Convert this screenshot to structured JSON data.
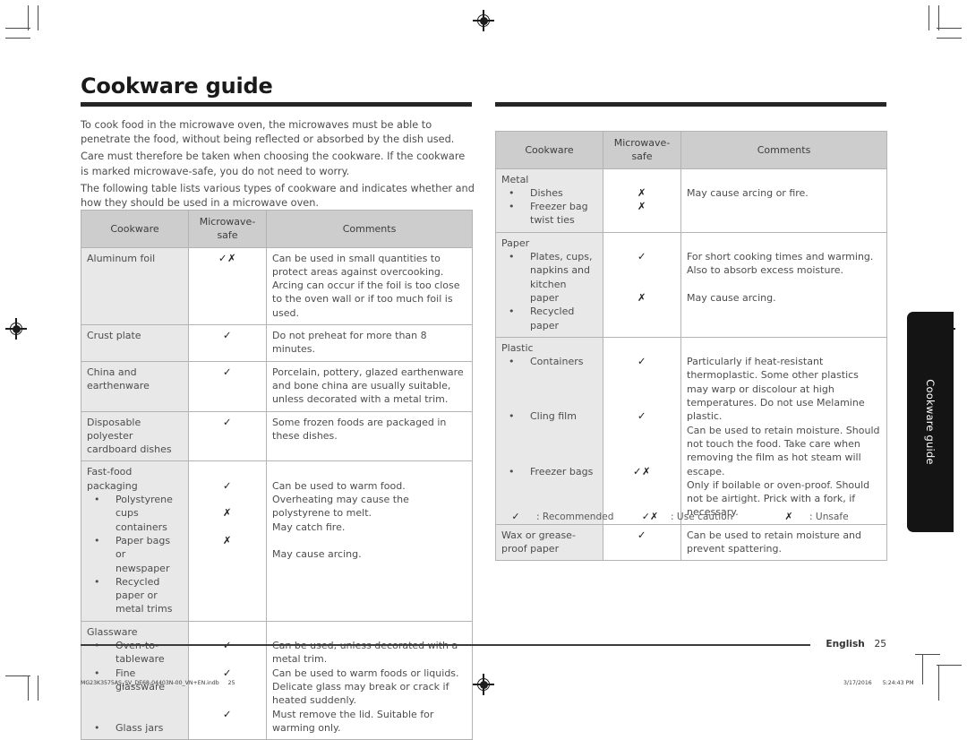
{
  "page": {
    "title": "Cookware guide",
    "side_tab_label": "Cookware guide",
    "footer_language": "English",
    "footer_page_number": "25",
    "print_filename": "MG23K3575AS_SV_DE68-04403N-00_VN+EN.indb",
    "print_page_number": "25",
    "print_date": "3/17/2016",
    "print_time": "5:24:43 PM"
  },
  "intro": {
    "p1": "To cook food in the microwave oven, the microwaves must be able to penetrate the food, without being reflected or absorbed by the dish used.",
    "p2": "Care must therefore be taken when choosing the cookware. If the cookware is marked microwave-safe, you do not need to worry.",
    "p3": "The following table lists various types of cookware and indicates whether and how they should be used in a microwave oven."
  },
  "table_headers": {
    "cookware": "Cookware",
    "microwave_safe": "Microwave-\nsafe",
    "microwave_safe_line1": "Microwave-",
    "microwave_safe_line2": "safe",
    "comments": "Comments"
  },
  "left_table": {
    "rows": [
      {
        "name": "Aluminum foil",
        "safe": "✓✗",
        "comment": "Can be used in small quantities to protect areas against overcooking. Arcing can occur if the foil is too close to the oven wall or if too much foil is used."
      },
      {
        "name": "Crust plate",
        "safe": "✓",
        "comment": "Do not preheat for more than 8 minutes."
      },
      {
        "name": "China and earthenware",
        "safe": "✓",
        "comment": "Porcelain, pottery, glazed earthenware and bone china are usually suitable, unless decorated with a metal trim."
      },
      {
        "name": "Disposable polyester cardboard dishes",
        "safe": "✓",
        "comment": "Some frozen foods are packaged in these dishes."
      }
    ],
    "group_fastfood": {
      "heading": "Fast-food packaging",
      "items": [
        {
          "name": "Polystyrene cups containers",
          "safe": "✓",
          "comment": "Can be used to warm food. Overheating may cause the polystyrene to melt."
        },
        {
          "name": "Paper bags or newspaper",
          "safe": "✗",
          "comment": "May catch fire."
        },
        {
          "name": "Recycled paper or metal trims",
          "safe": "✗",
          "comment": "May cause arcing."
        }
      ]
    },
    "group_glassware": {
      "heading": "Glassware",
      "items": [
        {
          "name": "Oven-to-tableware",
          "safe": "✓",
          "comment": "Can be used, unless decorated with a metal trim."
        },
        {
          "name": "Fine glassware",
          "safe": "✓",
          "comment": "Can be used to warm foods or liquids. Delicate glass may break or crack if heated suddenly."
        },
        {
          "name": "Glass jars",
          "safe": "✓",
          "comment": "Must remove the lid. Suitable for warming only."
        }
      ]
    }
  },
  "right_table": {
    "group_metal": {
      "heading": "Metal",
      "items": [
        {
          "name": "Dishes",
          "safe": "✗"
        },
        {
          "name": "Freezer bag twist ties",
          "safe": "✗"
        }
      ],
      "comment": "May cause arcing or fire."
    },
    "group_paper": {
      "heading": "Paper",
      "items": [
        {
          "name": "Plates, cups, napkins and kitchen paper",
          "safe": "✓",
          "comment": "For short cooking times and warming. Also to absorb excess moisture."
        },
        {
          "name": "Recycled paper",
          "safe": "✗",
          "comment": "May cause arcing."
        }
      ]
    },
    "group_plastic": {
      "heading": "Plastic",
      "items": [
        {
          "name": "Containers",
          "safe": "✓",
          "comment": "Particularly if heat-resistant thermoplastic. Some other plastics may warp or discolour at high temperatures. Do not use Melamine plastic."
        },
        {
          "name": "Cling film",
          "safe": "✓",
          "comment": "Can be used to retain moisture. Should not touch the food. Take care when removing the film as hot steam will escape."
        },
        {
          "name": "Freezer bags",
          "safe": "✓✗",
          "comment": "Only if boilable or oven-proof. Should not be airtight. Prick with a fork, if necessary."
        }
      ]
    },
    "row_wax": {
      "name": "Wax or grease-proof paper",
      "safe": "✓",
      "comment": "Can be used to retain moisture and prevent spattering."
    }
  },
  "legend": {
    "items": [
      {
        "symbol": "✓",
        "label": ": Recommended"
      },
      {
        "symbol": "✓✗",
        "label": ": Use caution"
      },
      {
        "symbol": "✗",
        "label": ": Unsafe"
      }
    ]
  },
  "colors": {
    "header_fill": "#cdcdcd",
    "name_column_fill": "#e8e8e8",
    "border": "#b3b3b3",
    "rule": "#262626",
    "tab_background": "#141414",
    "text": "#4d4d4d"
  }
}
